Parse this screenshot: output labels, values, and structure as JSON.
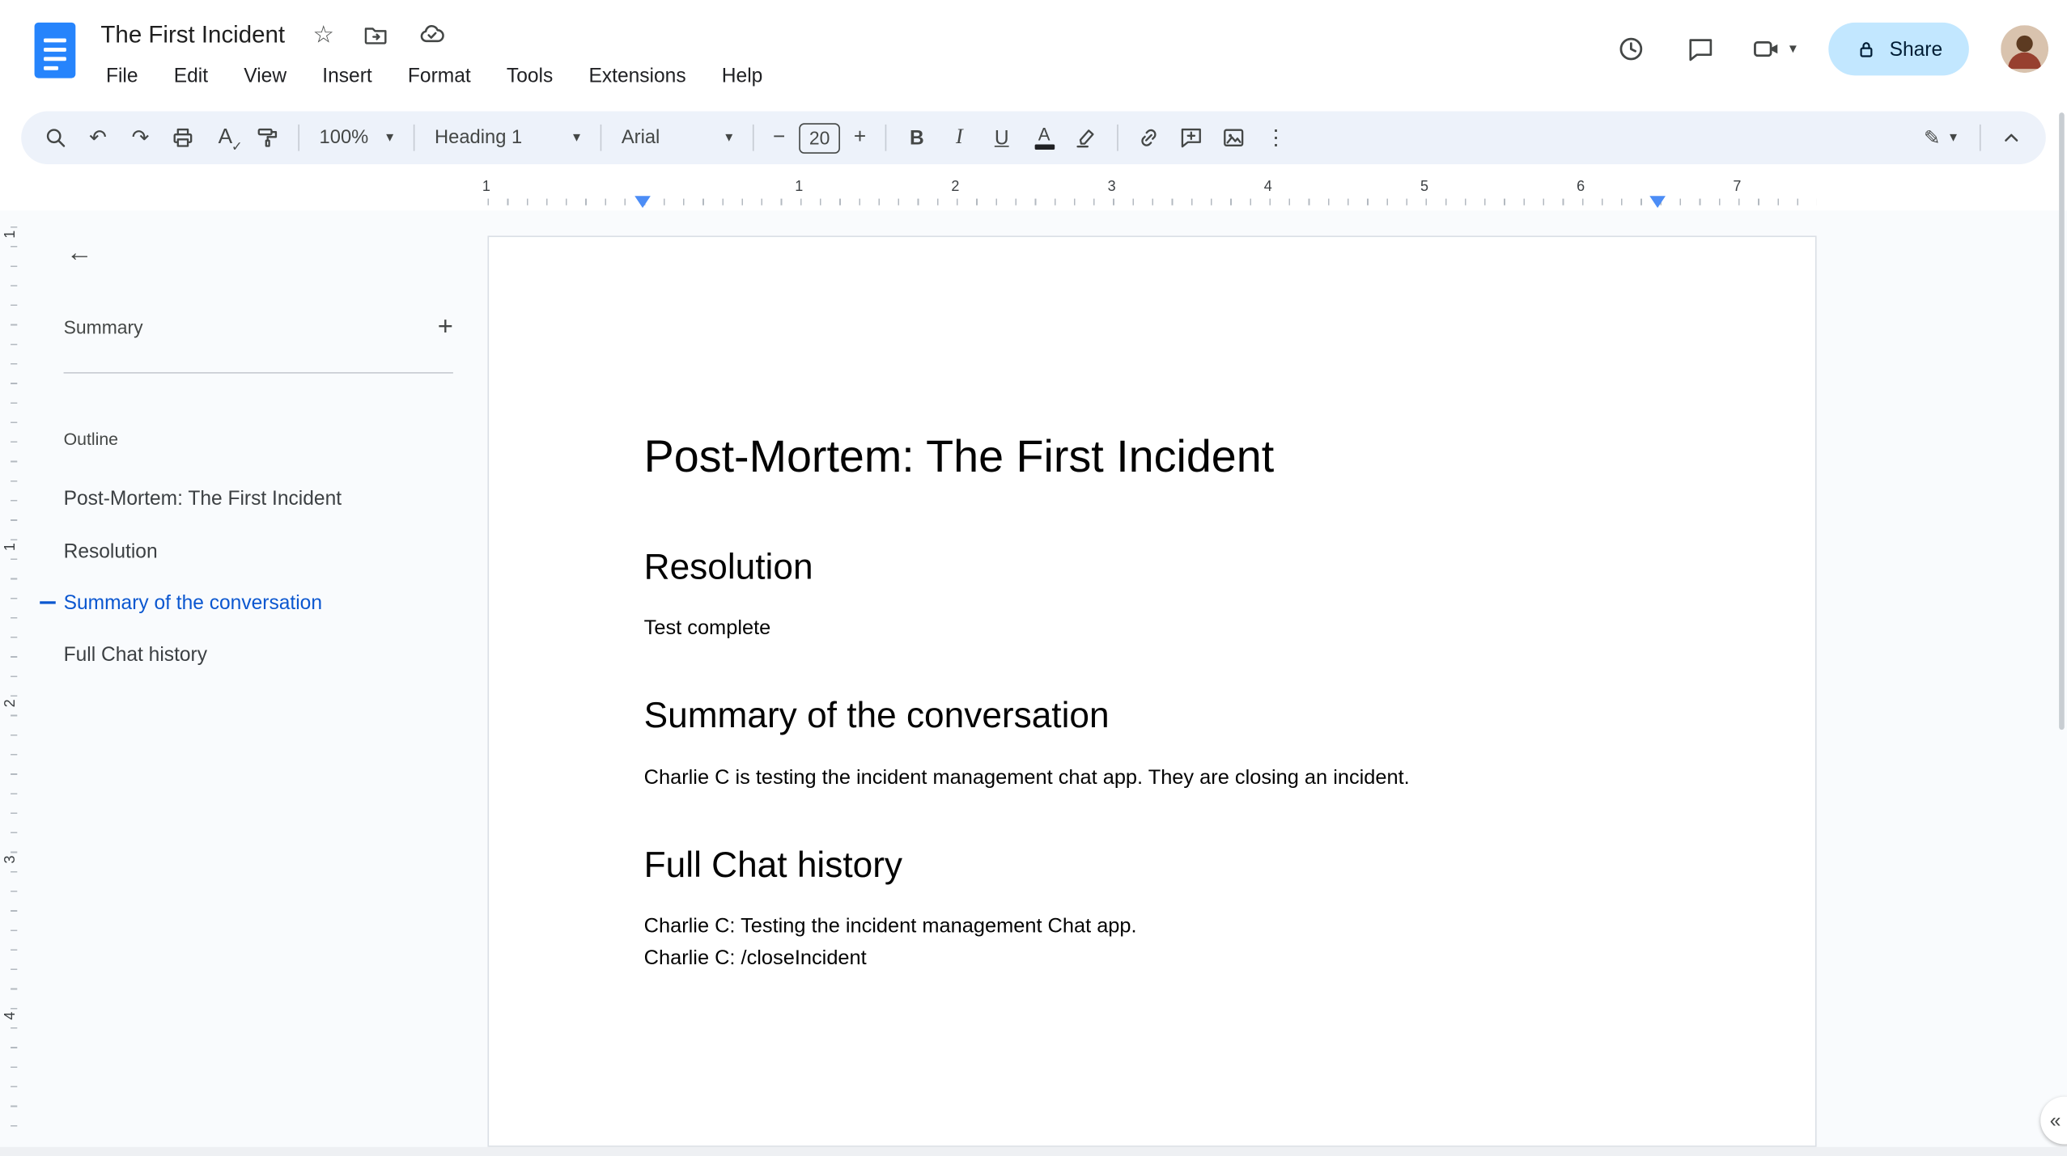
{
  "titlebar": {
    "doc_title": "The First Incident",
    "menus": [
      "File",
      "Edit",
      "View",
      "Insert",
      "Format",
      "Tools",
      "Extensions",
      "Help"
    ],
    "share_label": "Share"
  },
  "toolbar": {
    "zoom": "100%",
    "style": "Heading 1",
    "font": "Arial",
    "font_size": "20"
  },
  "sidebar": {
    "summary_label": "Summary",
    "outline_label": "Outline",
    "items": [
      {
        "label": "Post-Mortem: The First Incident",
        "active": false
      },
      {
        "label": "Resolution",
        "active": false
      },
      {
        "label": "Summary of the conversation",
        "active": true
      },
      {
        "label": "Full Chat history",
        "active": false
      }
    ]
  },
  "ruler": {
    "numbers": [
      "1",
      "1",
      "2",
      "3",
      "4",
      "5",
      "6",
      "7"
    ]
  },
  "vruler": {
    "numbers": [
      "1",
      "1",
      "2",
      "3",
      "4"
    ]
  },
  "document": {
    "h1": "Post-Mortem: The First Incident",
    "sections": [
      {
        "heading": "Resolution",
        "lines": [
          "Test complete"
        ]
      },
      {
        "heading": "Summary of the conversation",
        "lines": [
          "Charlie C is testing the incident management chat app. They are closing an incident."
        ]
      },
      {
        "heading": "Full Chat history",
        "lines": [
          "Charlie C: Testing the incident management Chat app.",
          "Charlie C: /closeIncident"
        ]
      }
    ]
  },
  "icons": {
    "star": "☆",
    "undo": "↶",
    "redo": "↷",
    "more_vertical": "⋮",
    "caret_down": "▾",
    "minus": "−",
    "plus": "+",
    "back_arrow": "←",
    "add": "+",
    "collapse_left": "«",
    "pencil": "✎",
    "check": "✓",
    "bold": "B",
    "italic": "I",
    "underline": "U",
    "text_color": "A",
    "spellcheck_letter": "A"
  },
  "colors": {
    "accent_blue": "#0b57d0",
    "share_bg": "#c2e7ff",
    "share_text": "#001d35",
    "toolbar_bg": "#edf2fa",
    "canvas_bg": "#f9fbfd",
    "icon_gray": "#444746",
    "docs_logo_blue": "#2684fc",
    "ruler_marker_blue": "#4c8df6",
    "outline_active": "#0b57d0"
  }
}
